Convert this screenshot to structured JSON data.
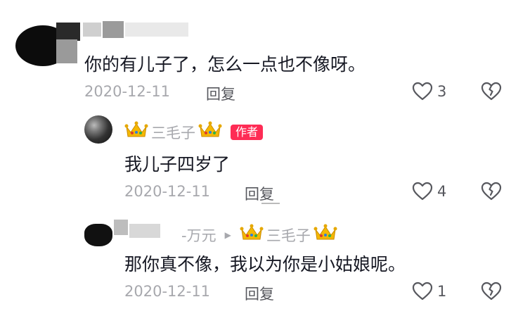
{
  "comment": {
    "text": "你的有儿子了，怎么一点也不像呀。",
    "date": "2020-12-11",
    "reply_label": "回复",
    "likes": "3"
  },
  "reply1": {
    "author": "三毛子",
    "author_badge": "作者",
    "text": "我儿子四岁了",
    "date": "2020-12-11",
    "reply_label": "回复",
    "likes": "4"
  },
  "reply2": {
    "author_partial": "-万元",
    "reply_to": "三毛子",
    "text": "那你真不像，我以为你是小姑娘呢。",
    "date": "2020-12-11",
    "reply_label": "回复",
    "likes": "1"
  },
  "icons": {
    "like": "heart-outline-icon",
    "dislike": "broken-heart-icon",
    "crown": "crown-emoji-icon",
    "reply_arrow": "triangle-right-icon"
  },
  "colors": {
    "badge": "#fe2c55",
    "meta": "#a7a8ad",
    "text": "#161823"
  }
}
